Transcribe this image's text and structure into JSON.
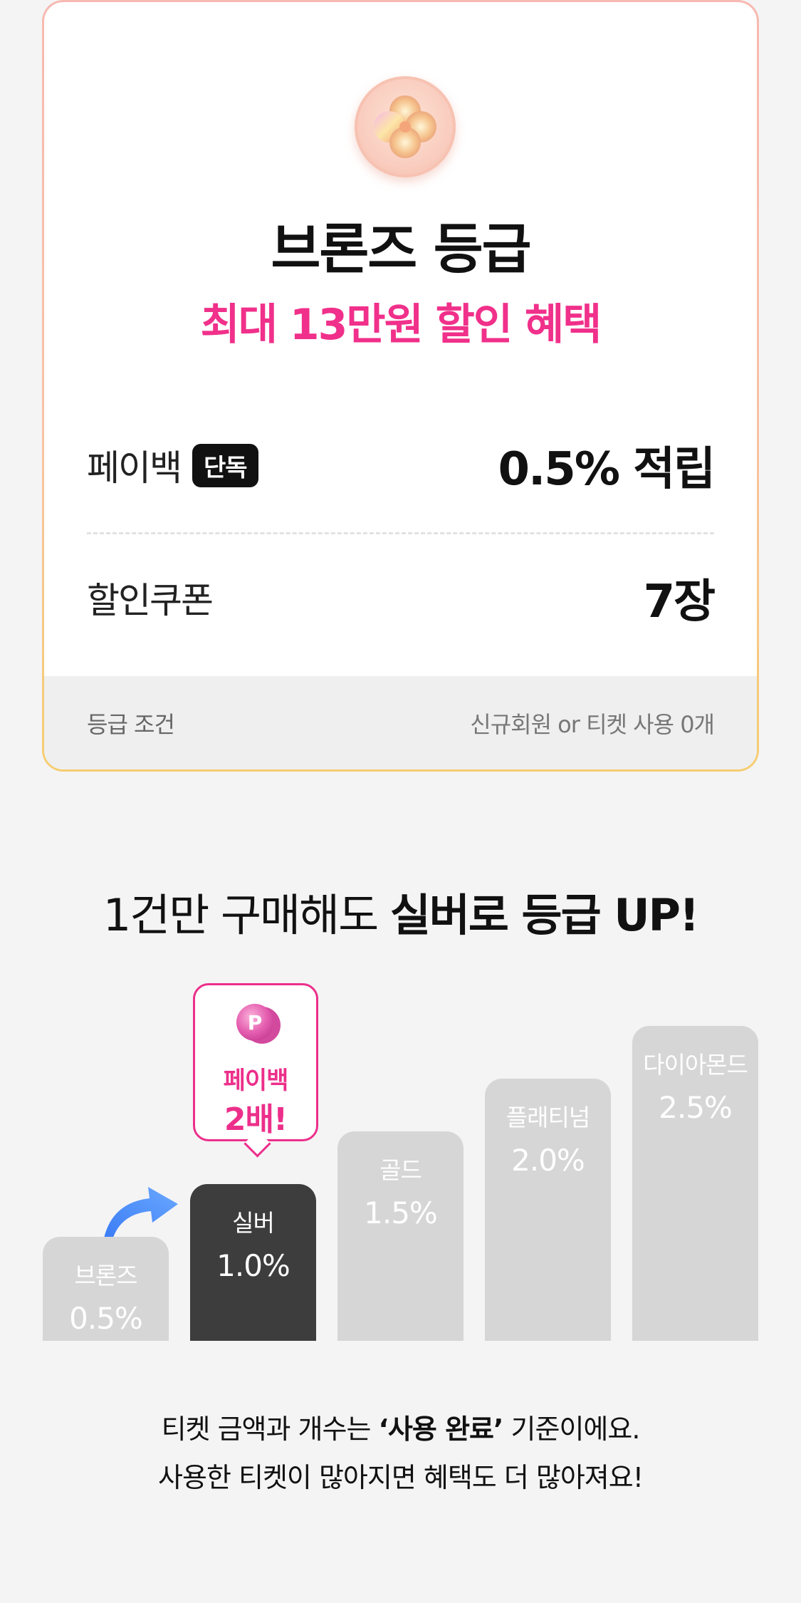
{
  "grade_card": {
    "title": "브론즈 등급",
    "subtitle": "최대 13만원 할인 혜택",
    "benefits": [
      {
        "label": "페이백",
        "tag": "단독",
        "value": "0.5% 적립"
      },
      {
        "label": "할인쿠폰",
        "value": "7장"
      }
    ],
    "condition": {
      "label": "등급 조건",
      "value": "신규회원 or 티켓 사용 0개"
    },
    "colors": {
      "accent": "#f0308a",
      "border_top": "#f7b9b1",
      "border_bottom": "#f6cd6f"
    }
  },
  "headline": {
    "normal": "1건만 구매해도 ",
    "bold": "실버로 등급 UP!"
  },
  "chart_data": {
    "type": "bar",
    "categories": [
      "브론즈",
      "실버",
      "골드",
      "플래티넘",
      "다이아몬드"
    ],
    "values": [
      0.5,
      1.0,
      1.5,
      2.0,
      2.5
    ],
    "labels": [
      "0.5%",
      "1.0%",
      "1.5%",
      "2.0%",
      "2.5%"
    ],
    "highlight_index": 1,
    "callout": {
      "line1": "페이백",
      "line2": "2배!",
      "icon": "p-coin-icon"
    },
    "colors": {
      "default": "#d6d6d6",
      "highlight": "#3d3d3d",
      "callout": "#ec2f8a"
    }
  },
  "footnote": {
    "line1_pre": "티켓 금액과 개수는 ",
    "line1_bold": "‘사용 완료’",
    "line1_post": " 기준이에요.",
    "line2": "사용한 티켓이 많아지면 혜택도 더 많아져요!"
  }
}
